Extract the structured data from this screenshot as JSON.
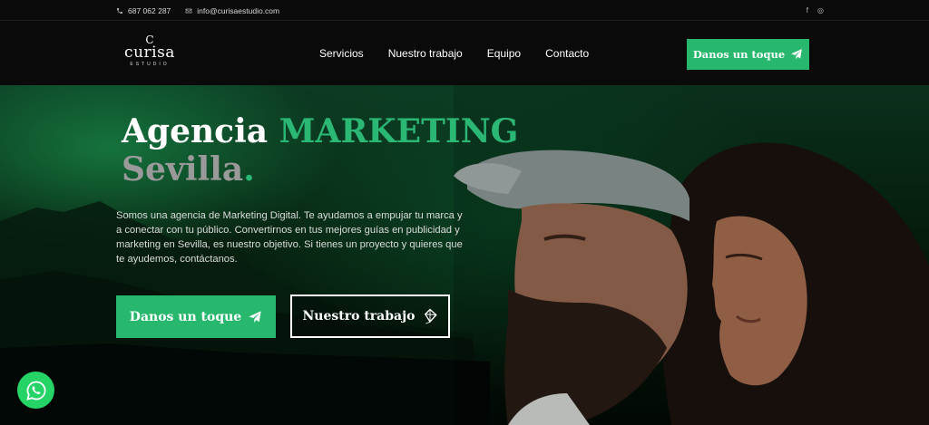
{
  "topbar": {
    "phone": "687 062 287",
    "email": "info@curisaestudio.com",
    "social_icons": [
      "facebook-icon",
      "instagram-icon"
    ]
  },
  "header": {
    "logo": {
      "mark": "C",
      "name": "curisa",
      "sub": "ESTUDIO"
    },
    "nav": [
      "Servicios",
      "Nuestro trabajo",
      "Equipo",
      "Contacto"
    ],
    "cta": "Danos un toque"
  },
  "hero": {
    "headline_1": "Agencia",
    "headline_2": "MARKETING",
    "headline_3": "Sevilla",
    "headline_dot": ".",
    "description": "Somos una agencia de Marketing Digital. Te ayudamos a empujar tu marca y a conectar con tu público. Convertirnos en tus mejores guías en publicidad y marketing en Sevilla, es nuestro objetivo. Si tienes un proyecto y quieres que te ayudemos, contáctanos.",
    "button_primary": "Danos un toque",
    "button_secondary": "Nuestro trabajo"
  },
  "colors": {
    "accent": "#27b86d",
    "headline_green": "#2bb774",
    "headline_gray": "#9a9a9a",
    "background": "#0a0a0a"
  }
}
